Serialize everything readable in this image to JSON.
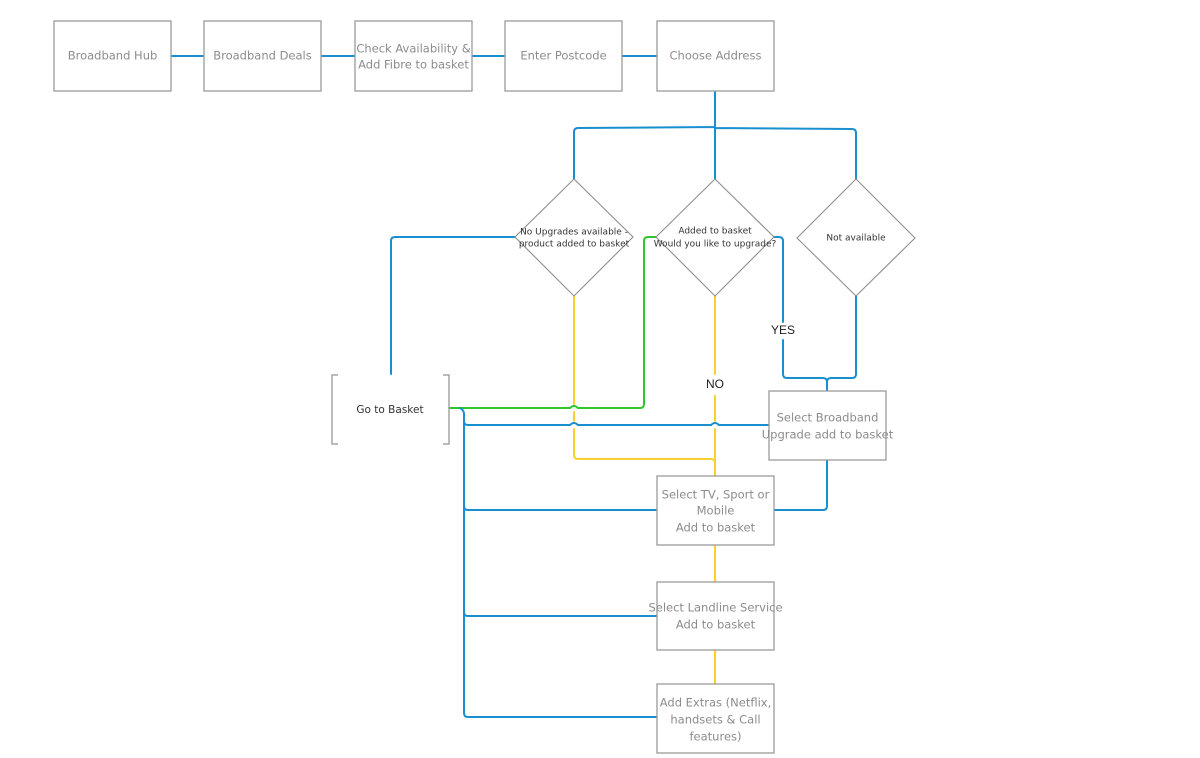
{
  "colors": {
    "blue": "#1a8fd0",
    "yellow": "#f7d22e",
    "green": "#2fc72a",
    "box_border": "#9a9a9a",
    "box_text": "#8c8c8c"
  },
  "nodes": {
    "broadband_hub": {
      "lines": [
        "Broadband Hub"
      ]
    },
    "broadband_deals": {
      "lines": [
        "Broadband Deals"
      ]
    },
    "check_availability": {
      "lines": [
        "Check Availability &",
        "Add Fibre to basket"
      ]
    },
    "enter_postcode": {
      "lines": [
        "Enter Postcode"
      ]
    },
    "choose_address": {
      "lines": [
        "Choose Address"
      ]
    },
    "no_upgrades": {
      "lines": [
        "No Upgrades available -",
        "product added to basket"
      ]
    },
    "added_to_basket": {
      "lines": [
        "Added to basket",
        "Would you like to upgrade?"
      ]
    },
    "not_available": {
      "lines": [
        "Not available"
      ]
    },
    "go_to_basket": {
      "lines": [
        "Go to Basket"
      ]
    },
    "select_upgrade": {
      "lines": [
        "Select Broadband",
        "Upgrade add to basket"
      ]
    },
    "select_tv": {
      "lines": [
        "Select TV, Sport or",
        "Mobile",
        "Add to basket"
      ]
    },
    "select_landline": {
      "lines": [
        "Select Landline Service",
        "Add to basket"
      ]
    },
    "add_extras": {
      "lines": [
        "Add Extras (Netflix,",
        "handsets & Call",
        "features)"
      ]
    }
  },
  "edge_labels": {
    "yes": "YES",
    "no": "NO"
  }
}
